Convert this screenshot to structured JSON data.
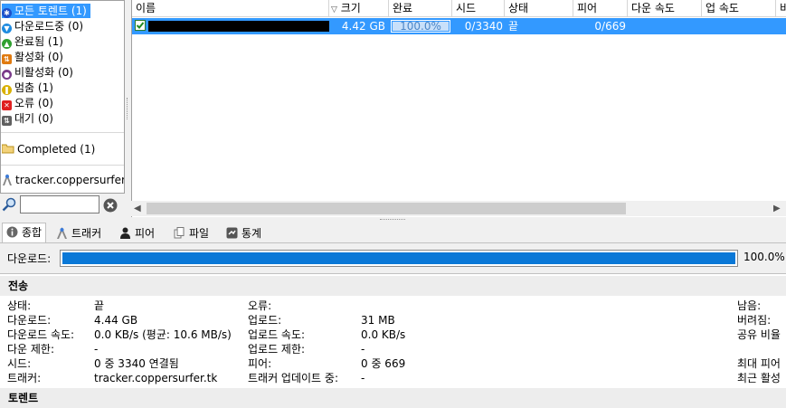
{
  "sidebar": {
    "items": [
      {
        "label": "모든 토렌트 (1)",
        "icon": "all-icon",
        "color": "#1e4fc8"
      },
      {
        "label": "다운로드중 (0)",
        "icon": "download-icon",
        "color": "#1e8be0"
      },
      {
        "label": "완료됨 (1)",
        "icon": "seed-icon",
        "color": "#30a030"
      },
      {
        "label": "활성화 (0)",
        "icon": "active-icon",
        "color": "#e07a10"
      },
      {
        "label": "비활성화 (0)",
        "icon": "inactive-icon",
        "color": "#7a3a8a"
      },
      {
        "label": "멈춤 (1)",
        "icon": "pause-icon",
        "color": "#d8b000"
      },
      {
        "label": "오류 (0)",
        "icon": "error-icon",
        "color": "#e02020"
      },
      {
        "label": "대기 (0)",
        "icon": "queue-icon",
        "color": "#606060"
      }
    ],
    "label_completed": "Completed (1)",
    "tracker": "tracker.coppersurfer"
  },
  "filter": {
    "placeholder": ""
  },
  "list": {
    "columns": [
      "이름",
      "크기",
      "완료",
      "시드",
      "상태",
      "피어",
      "다운 속도",
      "업 속도",
      "비"
    ],
    "row": {
      "name": "",
      "size": "4.42 GB",
      "done": "100.0%",
      "done_fraction": 1.0,
      "seeds": "0/3340",
      "status": "끝",
      "peers": "0/669"
    }
  },
  "tabs": [
    "종합",
    "트래커",
    "피어",
    "파일",
    "통계"
  ],
  "download": {
    "label": "다운로드:",
    "percent": "100.0%",
    "fraction": 1.0
  },
  "details": {
    "section_transfer": "전송",
    "section_next": "토렌트",
    "col1": {
      "labels": [
        "상태:",
        "다운로드:",
        "다운로드 속도:",
        "다운 제한:",
        "시드:",
        "트래커:"
      ],
      "values": [
        "끝",
        "4.44 GB",
        "0.0 KB/s (평균: 10.6 MB/s)",
        "-",
        "0 중 3340 연결됨",
        "tracker.coppersurfer.tk"
      ]
    },
    "col2": {
      "labels": [
        "오류:",
        "업로드:",
        "업로드 속도:",
        "업로드 제한:",
        "피어:",
        "트래커 업데이트 중:"
      ],
      "values": [
        "",
        "31 MB",
        "0.0 KB/s",
        "-",
        "0 중 669",
        "-"
      ]
    },
    "col3": {
      "labels": [
        "남음:",
        "버려짐:",
        "공유 비율",
        "",
        "최대 피어",
        "최근 활성"
      ]
    }
  },
  "colors": {
    "selection": "#3399ff",
    "progress": "#0a78d7"
  }
}
